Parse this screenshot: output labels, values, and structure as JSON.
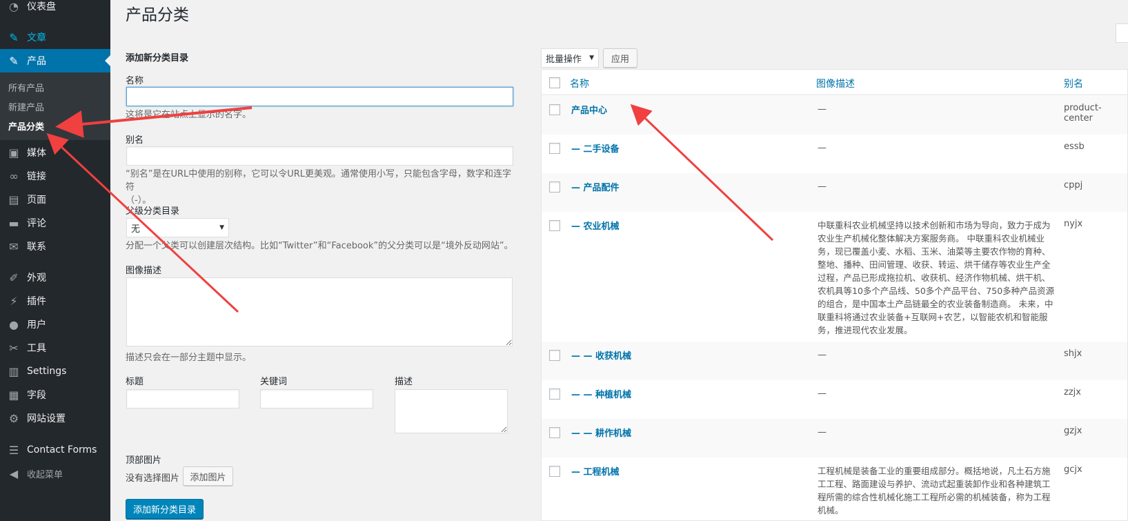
{
  "sidebar": {
    "items": [
      {
        "label": "仪表盘",
        "icon": "dashboard-icon"
      },
      {
        "label": "文章",
        "icon": "pin-icon"
      },
      {
        "label": "产品",
        "icon": "pin-icon"
      },
      {
        "label": "媒体",
        "icon": "media-icon"
      },
      {
        "label": "链接",
        "icon": "link-icon"
      },
      {
        "label": "页面",
        "icon": "page-icon"
      },
      {
        "label": "评论",
        "icon": "comment-icon"
      },
      {
        "label": "联系",
        "icon": "mail-icon"
      },
      {
        "label": "外观",
        "icon": "brush-icon"
      },
      {
        "label": "插件",
        "icon": "plugin-icon"
      },
      {
        "label": "用户",
        "icon": "user-icon"
      },
      {
        "label": "工具",
        "icon": "wrench-icon"
      },
      {
        "label": "Settings",
        "icon": "settings-icon"
      },
      {
        "label": "字段",
        "icon": "fields-icon"
      },
      {
        "label": "网站设置",
        "icon": "gear-icon"
      },
      {
        "label": "Contact Forms",
        "icon": "list-icon"
      },
      {
        "label": "收起菜单",
        "icon": "collapse-icon"
      }
    ],
    "submenu": [
      "所有产品",
      "新建产品",
      "产品分类"
    ]
  },
  "page": {
    "title": "产品分类"
  },
  "form": {
    "heading": "添加新分类目录",
    "name_label": "名称",
    "name_value": "",
    "name_help": "这将是它在站点上显示的名字。",
    "slug_label": "别名",
    "slug_help_1": "“别名”是在URL中使用的别称，它可以令URL更美观。通常使用小写，只能包含字母，数字和连字符",
    "slug_help_2": "（-）。",
    "parent_label": "父级分类目录",
    "parent_value": "无",
    "parent_help": "分配一个父类可以创建层次结构。比如“Twitter”和“Facebook”的父分类可以是“境外反动网站”。",
    "image_desc_label": "图像描述",
    "image_desc_help": "描述只会在一部分主题中显示。",
    "seo_title_label": "标题",
    "seo_keywords_label": "关键词",
    "seo_desc_label": "描述",
    "header_image_label": "顶部图片",
    "no_image_text": "没有选择图片",
    "add_image_button": "添加图片",
    "submit_button": "添加新分类目录"
  },
  "table": {
    "bulk_action": "批量操作",
    "apply_button": "应用",
    "columns": [
      "名称",
      "图像描述",
      "别名"
    ],
    "rows": [
      {
        "name": "产品中心",
        "desc": "—",
        "slug": "product-center"
      },
      {
        "name": "— 二手设备",
        "desc": "—",
        "slug": "essb"
      },
      {
        "name": "— 产品配件",
        "desc": "—",
        "slug": "cppj"
      },
      {
        "name": "— 农业机械",
        "desc": "中联重科农业机械坚持以技术创新和市场为导向，致力于成为农业生产机械化整体解决方案服务商。 中联重科农业机械业务，现已覆盖小麦、水稻、玉米、油菜等主要农作物的育种、整地、播种、田间管理、收获、转运、烘干储存等农业生产全过程，产品已形成拖拉机、收获机、经济作物机械、烘干机、农机具等10多个产品线、50多个产品平台、750多种产品资源的组合，是中国本土产品链最全的农业装备制造商。 未来，中联重科将通过农业装备+互联网+农艺，以智能农机和智能服务，推进现代农业发展。",
        "slug": "nyjx"
      },
      {
        "name": "— — 收获机械",
        "desc": "—",
        "slug": "shjx"
      },
      {
        "name": "— — 种植机械",
        "desc": "—",
        "slug": "zzjx"
      },
      {
        "name": "— — 耕作机械",
        "desc": "—",
        "slug": "gzjx"
      },
      {
        "name": "— 工程机械",
        "desc": "工程机械是装备工业的重要组成部分。概括地说，凡土石方施工工程、路面建设与养护、流动式起重装卸作业和各种建筑工程所需的综合性机械化施工工程所必需的机械装备，称为工程机械。",
        "slug": "gcjx"
      }
    ]
  },
  "colors": {
    "sidebar_bg": "#23282d",
    "accent": "#0073aa",
    "arrow": "#f04040"
  }
}
